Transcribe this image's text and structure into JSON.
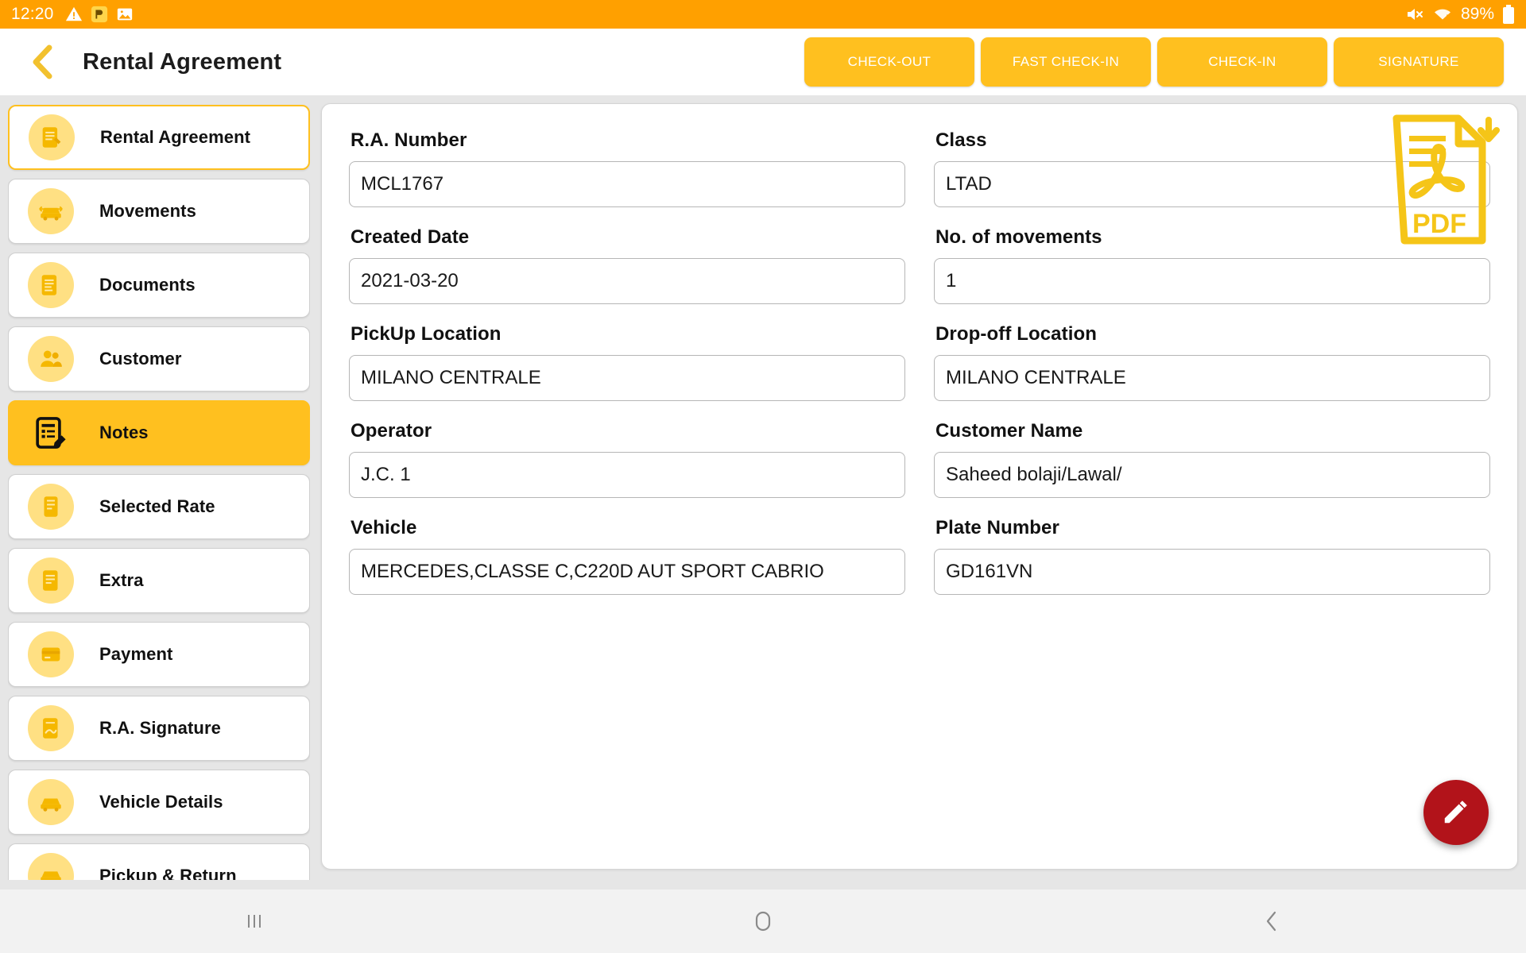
{
  "status_bar": {
    "time": "12:20",
    "battery_percent": "89%",
    "icons": [
      "warning-icon",
      "app-notification-icon",
      "image-icon",
      "mute-icon",
      "wifi-icon",
      "battery-icon"
    ]
  },
  "header": {
    "back_icon": "back-chevron-icon",
    "title": "Rental Agreement",
    "actions": [
      {
        "label": "CHECK-OUT",
        "name": "check-out-button"
      },
      {
        "label": "FAST CHECK-IN",
        "name": "fast-check-in-button"
      },
      {
        "label": "CHECK-IN",
        "name": "check-in-button"
      },
      {
        "label": "SIGNATURE",
        "name": "signature-button"
      }
    ]
  },
  "sidebar": {
    "items": [
      {
        "label": "Rental Agreement",
        "icon": "document-pen-icon",
        "state": "outlined"
      },
      {
        "label": "Movements",
        "icon": "car-movement-icon",
        "state": "normal"
      },
      {
        "label": "Documents",
        "icon": "documents-icon",
        "state": "normal"
      },
      {
        "label": "Customer",
        "icon": "customer-icon",
        "state": "normal"
      },
      {
        "label": "Notes",
        "icon": "notes-pencil-icon",
        "state": "active"
      },
      {
        "label": "Selected Rate",
        "icon": "rate-icon",
        "state": "normal"
      },
      {
        "label": "Extra",
        "icon": "extra-icon",
        "state": "normal"
      },
      {
        "label": "Payment",
        "icon": "payment-icon",
        "state": "normal"
      },
      {
        "label": "R.A. Signature",
        "icon": "signature-icon",
        "state": "normal"
      },
      {
        "label": "Vehicle Details",
        "icon": "vehicle-details-icon",
        "state": "normal"
      },
      {
        "label": "Pickup & Return",
        "icon": "pickup-return-icon",
        "state": "normal"
      }
    ]
  },
  "form": {
    "pdf_icon_label": "PDF",
    "fields": {
      "ra_number": {
        "label": "R.A. Number",
        "value": "MCL1767"
      },
      "class": {
        "label": "Class",
        "value": "LTAD"
      },
      "created_date": {
        "label": "Created Date",
        "value": "2021-03-20"
      },
      "no_of_movements": {
        "label": "No. of movements",
        "value": "1"
      },
      "pickup_location": {
        "label": "PickUp Location",
        "value": "MILANO CENTRALE"
      },
      "dropoff_location": {
        "label": "Drop-off Location",
        "value": "MILANO CENTRALE"
      },
      "operator": {
        "label": "Operator",
        "value": "J.C. 1"
      },
      "customer_name": {
        "label": "Customer Name",
        "value": "Saheed bolaji/Lawal/"
      },
      "vehicle": {
        "label": "Vehicle",
        "value": "MERCEDES,CLASSE C,C220D AUT SPORT CABRIO"
      },
      "plate_number": {
        "label": "Plate Number",
        "value": "GD161VN"
      }
    }
  },
  "fab": {
    "icon": "edit-pencil-icon"
  },
  "nav_bar": {
    "recents_icon": "recents-icon",
    "home_icon": "home-icon",
    "back_icon": "back-icon"
  },
  "colors": {
    "status_bar_orange": "#ffa000",
    "accent_yellow": "#ffc01f",
    "icon_badge_yellow": "#ffe083",
    "fab_red": "#b2131a",
    "body_gray": "#e6e6e6"
  }
}
